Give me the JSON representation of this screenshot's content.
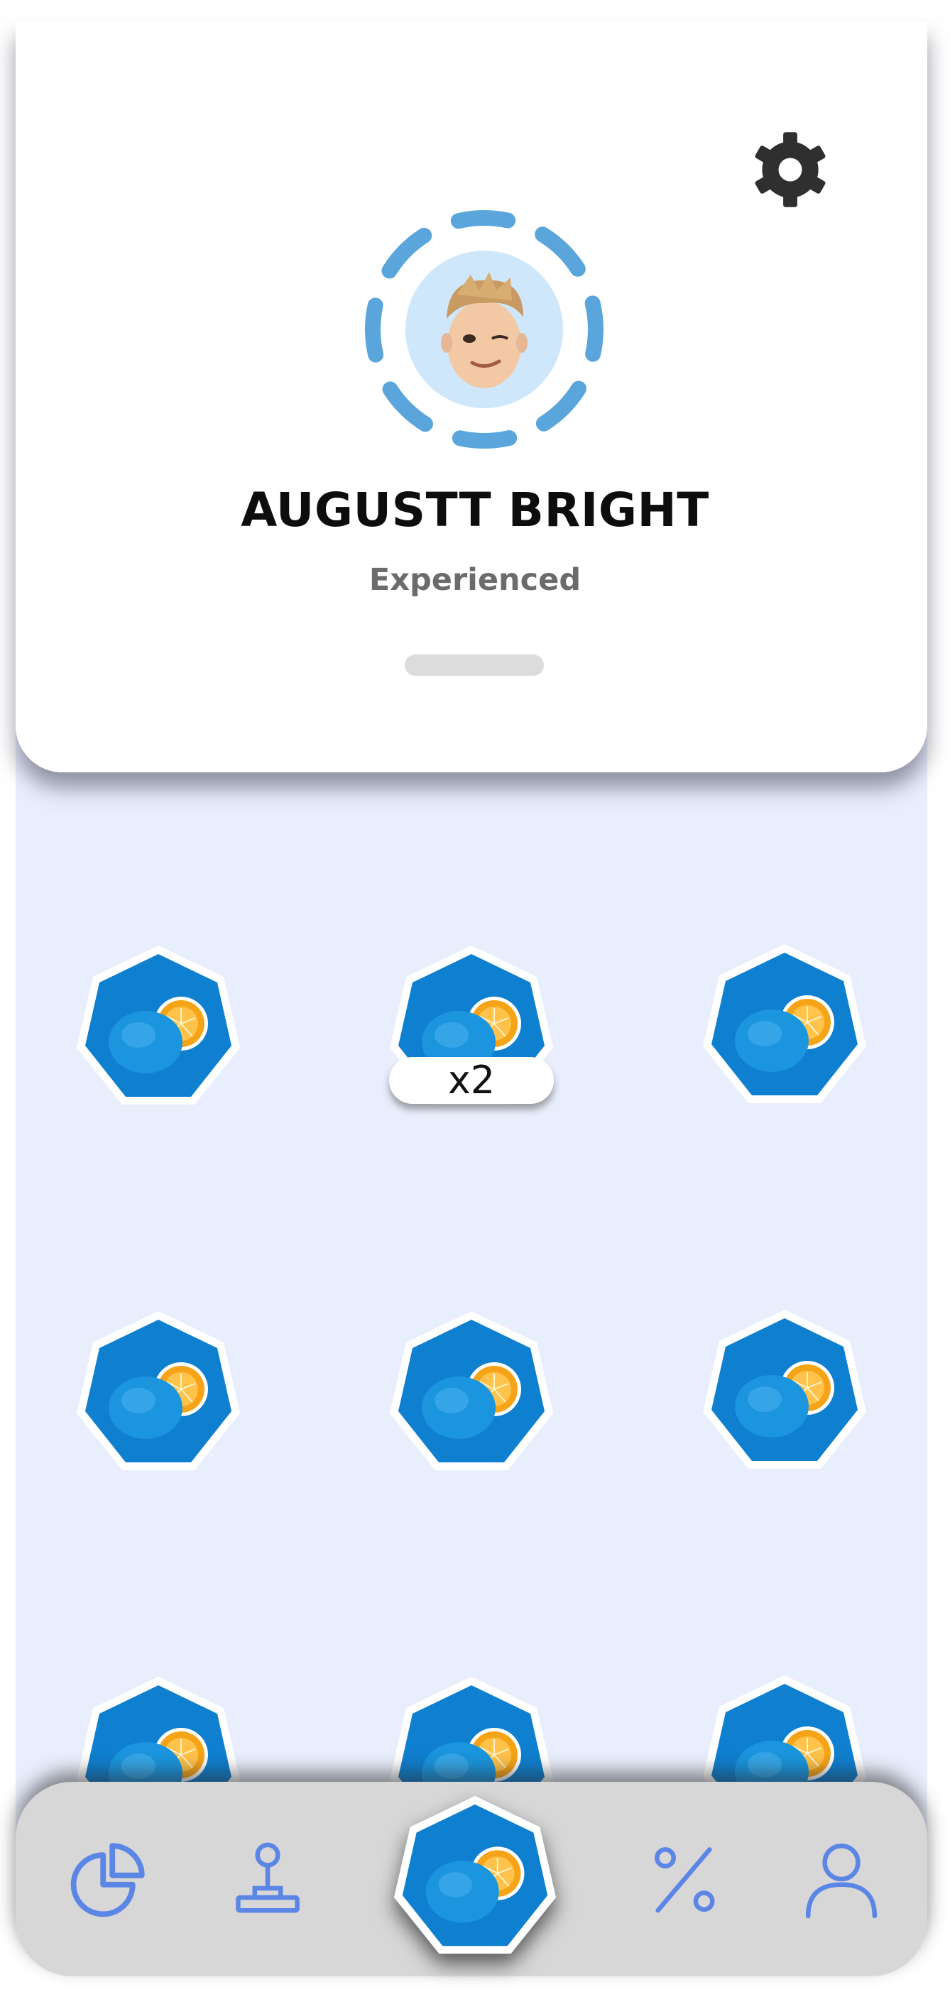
{
  "profile": {
    "name": "AUGUSTT BRIGHT",
    "level": "Experienced",
    "avatar_icon": "memoji-avatar",
    "settings_icon": "gear-icon"
  },
  "badges": [
    {
      "icon": "blue-orange-badge",
      "count": ""
    },
    {
      "icon": "blue-orange-badge",
      "count": "x2"
    },
    {
      "icon": "blue-orange-badge",
      "count": ""
    },
    {
      "icon": "blue-orange-badge",
      "count": ""
    },
    {
      "icon": "blue-orange-badge",
      "count": ""
    },
    {
      "icon": "blue-orange-badge",
      "count": ""
    },
    {
      "icon": "blue-orange-badge",
      "count": ""
    },
    {
      "icon": "blue-orange-badge",
      "count": ""
    },
    {
      "icon": "blue-orange-badge",
      "count": ""
    }
  ],
  "nav": {
    "items": [
      {
        "icon": "pie-chart-icon"
      },
      {
        "icon": "joystick-icon"
      },
      {
        "icon": "badge-icon",
        "active": true
      },
      {
        "icon": "percent-icon"
      },
      {
        "icon": "user-icon"
      }
    ]
  },
  "colors": {
    "accent": "#5b86e6",
    "badge_blue": "#0e7fd0",
    "orange": "#f5a21b",
    "card_bg": "#ffffff",
    "grid_bg": "#e9eefc",
    "nav_bg": "#d7d7d7",
    "avatar_ring": "#5aa6dc"
  }
}
